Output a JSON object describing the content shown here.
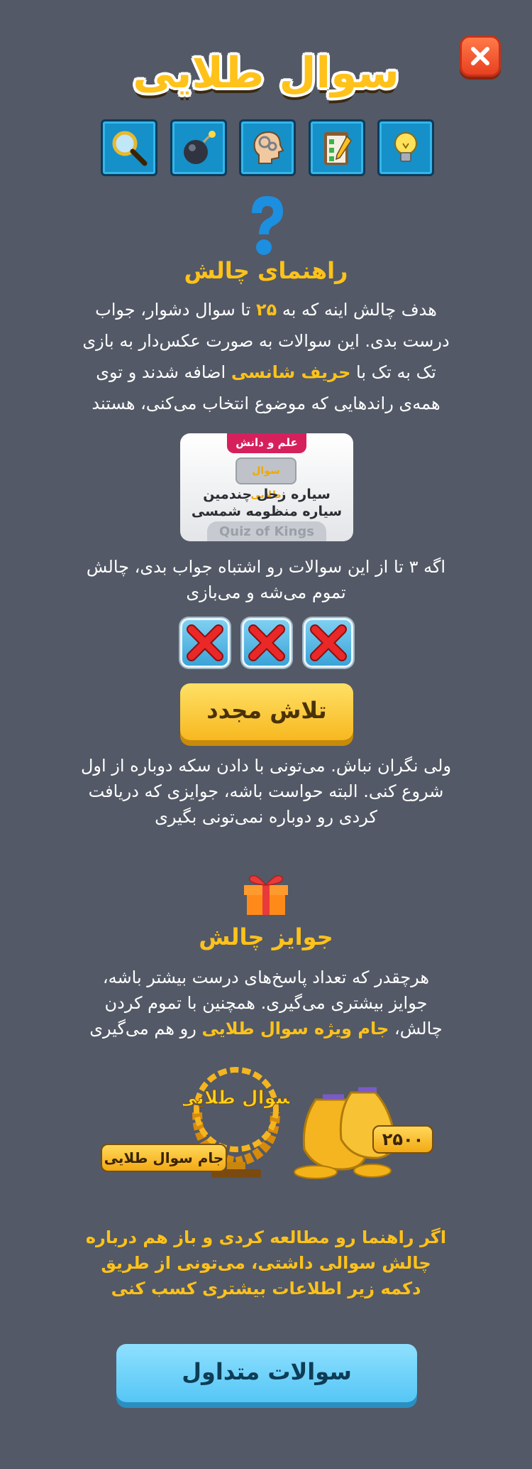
{
  "header": {
    "title": "سوال طلایی",
    "close_icon": "close-icon"
  },
  "categories": [
    {
      "icon": "magnifier-icon"
    },
    {
      "icon": "bomb-icon"
    },
    {
      "icon": "brain-head-icon"
    },
    {
      "icon": "checklist-icon"
    },
    {
      "icon": "lightbulb-icon"
    }
  ],
  "guide": {
    "title": "راهنمای چالش",
    "p1_a": "هدف چالش اینه که به",
    "p1_num": "۲۵",
    "p1_b": "تا سوال دشوار، جواب درست بدی. این سوالات به صورت عکس‌دار به بازی تک به تک با",
    "p1_hl": "حریف شانسی",
    "p1_c": "اضافه شدند و توی همه‌ی راندهایی که موضوع انتخاب می‌کنی، هستند",
    "card_tag": "علم و دانش",
    "card_mini": "سوال طلایی",
    "card_question": "سیاره زحل چندمین سیاره منظومه شمسی است؟",
    "card_brand": "Quiz of Kings",
    "p2": "اگه ۳ تا از این سوالات رو اشتباه جواب بدی، چالش تموم می‌شه و می‌بازی",
    "retry_label": "تلاش مجدد",
    "p3": "ولی نگران نباش. می‌تونی با دادن سکه دوباره از اول شروع کنی. البته حواست باشه، جوایزی که دریافت کردی رو دوباره نمی‌تونی بگیری"
  },
  "rewards": {
    "title": "جوایز چالش",
    "p_a": "هرچقدر که تعداد پاسخ‌های درست بیشتر باشه، جوایز بیشتری می‌گیری. همچنین با تموم کردن چالش،",
    "p_hl": "جام ویژه سوال طلایی",
    "p_b": "رو هم می‌گیری",
    "trophy_text": "سوال طلایی",
    "cup_label": "جام سوال طلایی",
    "coin_amount": "۲۵۰۰"
  },
  "footer": {
    "note": "اگر راهنما رو مطالعه کردی و باز هم درباره چالش سوالی داشتی، می‌تونی از طریق دکمه زیر اطلاعات بیشتری کسب کنی",
    "faq_label": "سوالات متداول"
  },
  "colors": {
    "background": "#535966",
    "accent": "#ffc21a",
    "close": "#e8401f",
    "faq": "#55c6f5"
  }
}
